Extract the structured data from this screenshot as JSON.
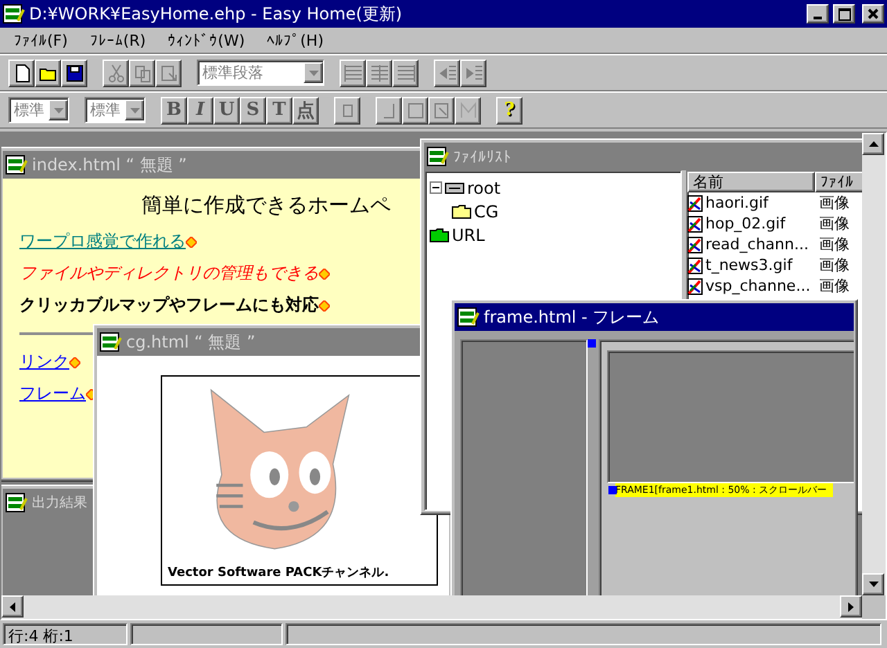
{
  "window": {
    "title": "D:¥WORK¥EasyHome.ehp - Easy Home(更新)"
  },
  "menu": [
    "ﾌｧｲﾙ(F)",
    "ﾌﾚｰﾑ(R)",
    "ｳｨﾝﾄﾞｳ(W)",
    "ﾍﾙﾌﾟ(H)"
  ],
  "toolbar_1": {
    "paragraph_style": "標準段落"
  },
  "toolbar_2": {
    "font_combo": "標準",
    "size_combo": "標準",
    "format_keys": [
      "B",
      "I",
      "U",
      "S",
      "T",
      "点"
    ],
    "help_key": "?"
  },
  "index_window": {
    "title": "index.html “ 無題 ”",
    "active": false,
    "heading": "簡単に作成できるホームペ",
    "paragraphs": [
      {
        "kind": "link",
        "text": "ワープロ感覚で作れる"
      },
      {
        "kind": "italic",
        "text": "ファイルやディレクトリの管理もできる"
      },
      {
        "kind": "bold",
        "text": "クリッカブルマップやフレームにも対応"
      },
      {
        "kind": "rule"
      },
      {
        "kind": "bluelink",
        "text": "リンク"
      },
      {
        "kind": "bluelink",
        "text": "フレーム"
      }
    ]
  },
  "output_window": {
    "title": "出力結果",
    "active": false
  },
  "cg_window": {
    "title": "cg.html “ 無題 ”",
    "active": false,
    "image_caption": "Vector Software PACKチャンネル."
  },
  "filelist_window": {
    "title": "ﾌｧｲﾙﾘｽﾄ",
    "active": false,
    "tree": [
      {
        "label": "root",
        "expanded": true,
        "children": [
          {
            "label": "CG"
          }
        ]
      },
      {
        "label": "URL"
      }
    ],
    "columns": [
      "名前",
      "ﾌｧｲﾙ"
    ],
    "rows": [
      {
        "name": "haori.gif",
        "type": "画像"
      },
      {
        "name": "hop_02.gif",
        "type": "画像"
      },
      {
        "name": "read_chann...",
        "type": "画像"
      },
      {
        "name": "t_news3.gif",
        "type": "画像"
      },
      {
        "name": "vsp_channe...",
        "type": "画像"
      }
    ]
  },
  "frame_window": {
    "title": "frame.html - フレーム",
    "active": true,
    "frame_label": "FRAME1[frame1.html : 50% : スクロールバー"
  },
  "status_bar": {
    "position": "行:4 桁:1"
  }
}
